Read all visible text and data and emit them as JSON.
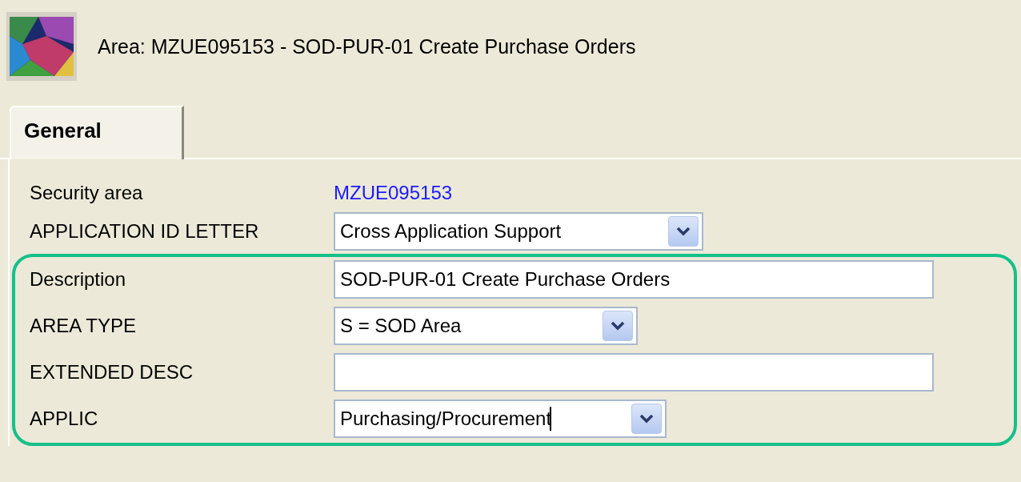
{
  "header": {
    "title": "Area: MZUE095153 - SOD-PUR-01 Create Purchase Orders"
  },
  "tabs": [
    {
      "label": "General",
      "selected": true
    }
  ],
  "fields": [
    {
      "kind": "link",
      "label": "Security area",
      "value": "MZUE095153"
    },
    {
      "kind": "dropdown",
      "label": "APPLICATION ID LETTER",
      "value": "Cross Application Support"
    }
  ],
  "highlighted_fields": [
    {
      "kind": "text",
      "label": "Description",
      "value": "SOD-PUR-01 Create Purchase Orders"
    },
    {
      "kind": "dropdown",
      "label": "AREA TYPE",
      "value": "S = SOD Area"
    },
    {
      "kind": "text",
      "label": "EXTENDED DESC"
    },
    {
      "kind": "dropdown",
      "label": "APPLIC",
      "value": "Purchasing/Procurement",
      "focused": true
    }
  ]
}
